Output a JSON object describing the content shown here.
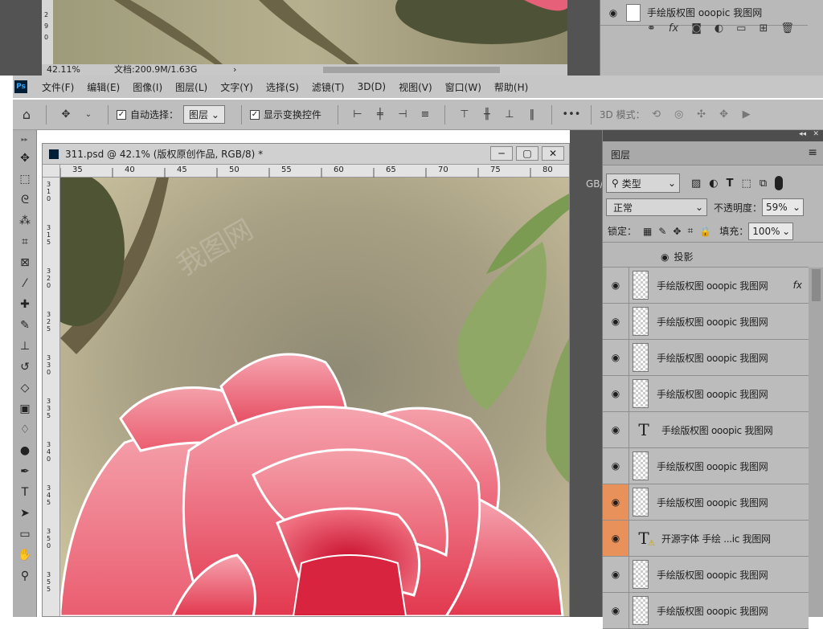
{
  "prev_window": {
    "zoom": "42.11%",
    "doc_info": "文档:200.9M/1.63G",
    "layer_name": "手绘版权图 ooopic 我图网",
    "ruler_marks": [
      "2",
      "9",
      "0"
    ]
  },
  "menubar": {
    "logo": "Ps",
    "items": [
      "文件(F)",
      "编辑(E)",
      "图像(I)",
      "图层(L)",
      "文字(Y)",
      "选择(S)",
      "滤镜(T)",
      "3D(D)",
      "视图(V)",
      "窗口(W)",
      "帮助(H)"
    ]
  },
  "optionsbar": {
    "auto_select_label": "自动选择：",
    "auto_select_value": "图层",
    "show_transform_label": "显示变换控件",
    "mode3d_label": "3D 模式：",
    "more": "•••"
  },
  "document": {
    "title": "311.psd @ 42.1% (版权原创作品, RGB/8) *",
    "ruler_h": [
      "35",
      "40",
      "45",
      "50",
      "55",
      "60",
      "65",
      "70",
      "75",
      "80"
    ],
    "ruler_v": [
      "3 1 0",
      "3 1 5",
      "3 2 0",
      "3 2 5",
      "3 3 0",
      "3 3 5",
      "3 4 0",
      "3 4 5",
      "3 5 0",
      "3 5 5"
    ],
    "right_edge_text": "GB/",
    "watermark": "我图网"
  },
  "layers_panel": {
    "tab": "图层",
    "filter_value": "类型",
    "blend_mode": "正常",
    "opacity_label": "不透明度：",
    "opacity_value": "59%",
    "lock_label": "锁定：",
    "fill_label": "填充：",
    "fill_value": "100%",
    "effect_label": "投影",
    "layers": [
      {
        "name": "手绘版权图 ooopic 我图网",
        "kind": "pixel",
        "fx": "fx",
        "selected": false
      },
      {
        "name": "手绘版权图 ooopic 我图网",
        "kind": "pixel",
        "selected": false
      },
      {
        "name": "手绘版权图 ooopic 我图网",
        "kind": "pixel",
        "selected": false
      },
      {
        "name": "手绘版权图 ooopic 我图网",
        "kind": "pixel",
        "selected": false
      },
      {
        "name": "手绘版权图 ooopic 我图网",
        "kind": "text",
        "selected": false
      },
      {
        "name": "手绘版权图 ooopic 我图网",
        "kind": "pixel",
        "selected": false
      },
      {
        "name": "手绘版权图 ooopic 我图网",
        "kind": "pixel",
        "selected": true
      },
      {
        "name": "开源字体 手绘 ...ic 我图网",
        "kind": "text-warning",
        "selected": true
      },
      {
        "name": "手绘版权图 ooopic 我图网",
        "kind": "pixel",
        "selected": false
      },
      {
        "name": "手绘版权图 ooopic 我图网",
        "kind": "pixel",
        "selected": false
      }
    ]
  },
  "colors": {
    "selected_layer": "#e8915a",
    "ui_gray": "#bcbcbc",
    "dark_gray": "#535353",
    "accent_green": "#3fbf3f"
  }
}
